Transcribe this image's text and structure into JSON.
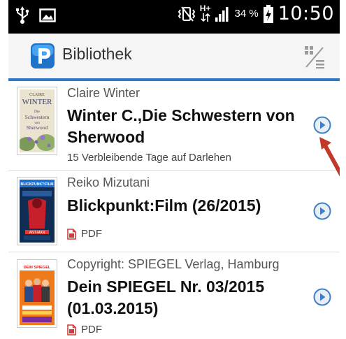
{
  "status_bar": {
    "battery_percent": "34 %",
    "time": "10:50",
    "network_label": "H+",
    "icons": [
      "usb-icon",
      "gallery-icon",
      "vibrate-icon",
      "network-icon",
      "signal-icon",
      "battery-icon"
    ]
  },
  "action_bar": {
    "title": "Bibliothek",
    "logo_icon": "app-logo-icon",
    "view_toggle_icon": "view-toggle-icon"
  },
  "items": [
    {
      "author": "Claire Winter",
      "title": "Winter C.,Die Schwestern von Sherwood",
      "meta": "15 Verbleibende Tage auf Darlehen",
      "meta_type": "loan",
      "cover": {
        "top_text": "CLAIRE",
        "name": "WINTER",
        "subtitle": "Die Schwestern von Sherwood"
      }
    },
    {
      "author": "Reiko Mizutani",
      "title": "Blickpunkt:Film (26/2015)",
      "meta": "PDF",
      "meta_type": "pdf",
      "cover": {
        "masthead": "BLICKPUNKT:FILM"
      }
    },
    {
      "author": "Copyright: SPIEGEL Verlag, Hamburg",
      "title": "Dein SPIEGEL Nr. 03/2015 (01.03.2015)",
      "meta": "PDF",
      "meta_type": "pdf",
      "cover": {
        "masthead": "DEIN SPIEGEL"
      }
    }
  ],
  "colors": {
    "accent_line": "#2f79c4",
    "arrow_button": "#3f7fc8",
    "pdf_icon": "#d33b3b",
    "annotation_arrow": "#c0392b"
  }
}
